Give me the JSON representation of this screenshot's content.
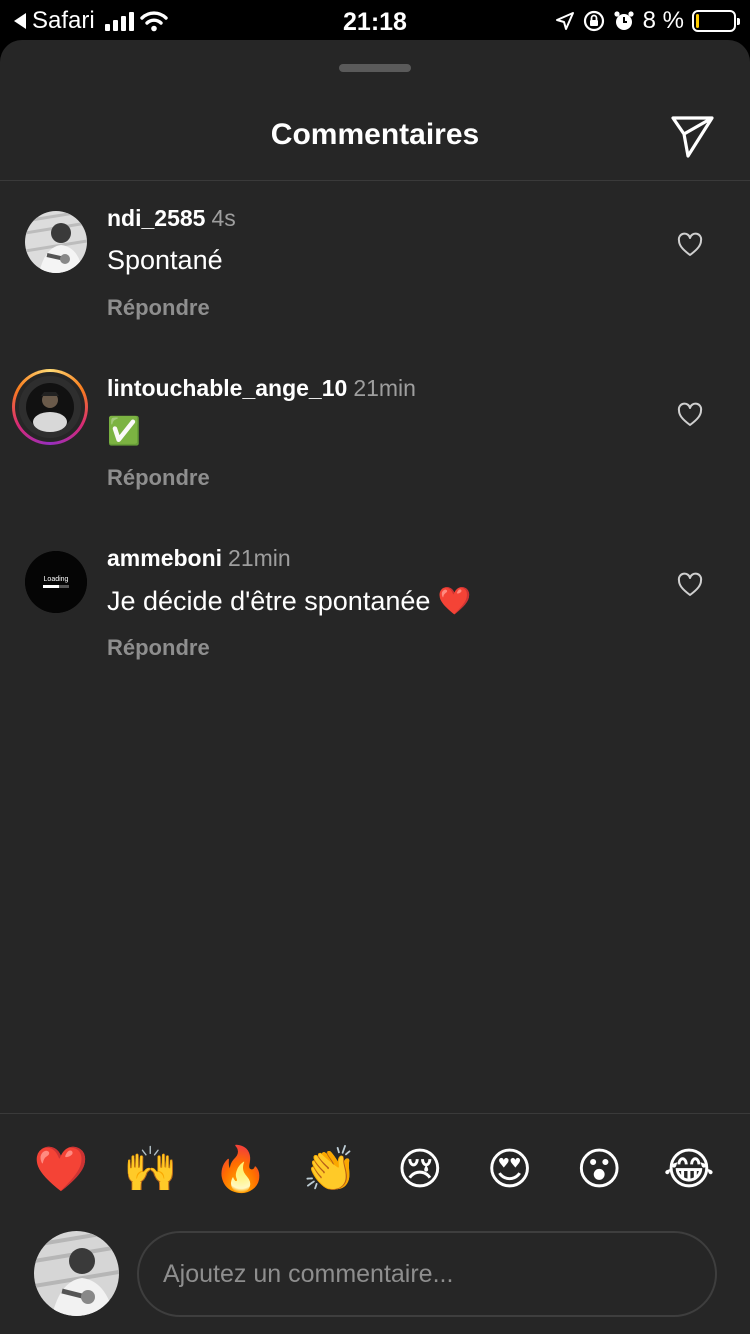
{
  "status_bar": {
    "back_app": "Safari",
    "time": "21:18",
    "battery_percent_text": "8 %",
    "battery_level": 0.08,
    "icons": [
      "back-arrow-icon",
      "signal-icon",
      "wifi-icon",
      "location-icon",
      "rotation-lock-icon",
      "alarm-icon",
      "battery-icon"
    ]
  },
  "sheet": {
    "title": "Commentaires",
    "share_icon": "paper-plane-icon"
  },
  "comments": [
    {
      "username": "ndi_2585",
      "time": "4s",
      "text": "Spontané",
      "reply_label": "Répondre",
      "has_story_ring": false
    },
    {
      "username": "lintouchable_ange_10",
      "time": "21min",
      "text": "✅",
      "reply_label": "Répondre",
      "has_story_ring": true
    },
    {
      "username": "ammeboni",
      "time": "21min",
      "text": "Je décide d'être spontanée ❤️",
      "reply_label": "Répondre",
      "has_story_ring": false,
      "avatar_text": "Loading"
    }
  ],
  "emoji_bar": [
    "❤️",
    "🙌",
    "🔥",
    "👏",
    "😢",
    "😍",
    "😮",
    "😂"
  ],
  "composer": {
    "placeholder": "Ajoutez un commentaire..."
  },
  "colors": {
    "background": "#262626",
    "status_bar": "#000000",
    "muted_text": "#8e8e8e",
    "battery": "#ffcc00"
  }
}
